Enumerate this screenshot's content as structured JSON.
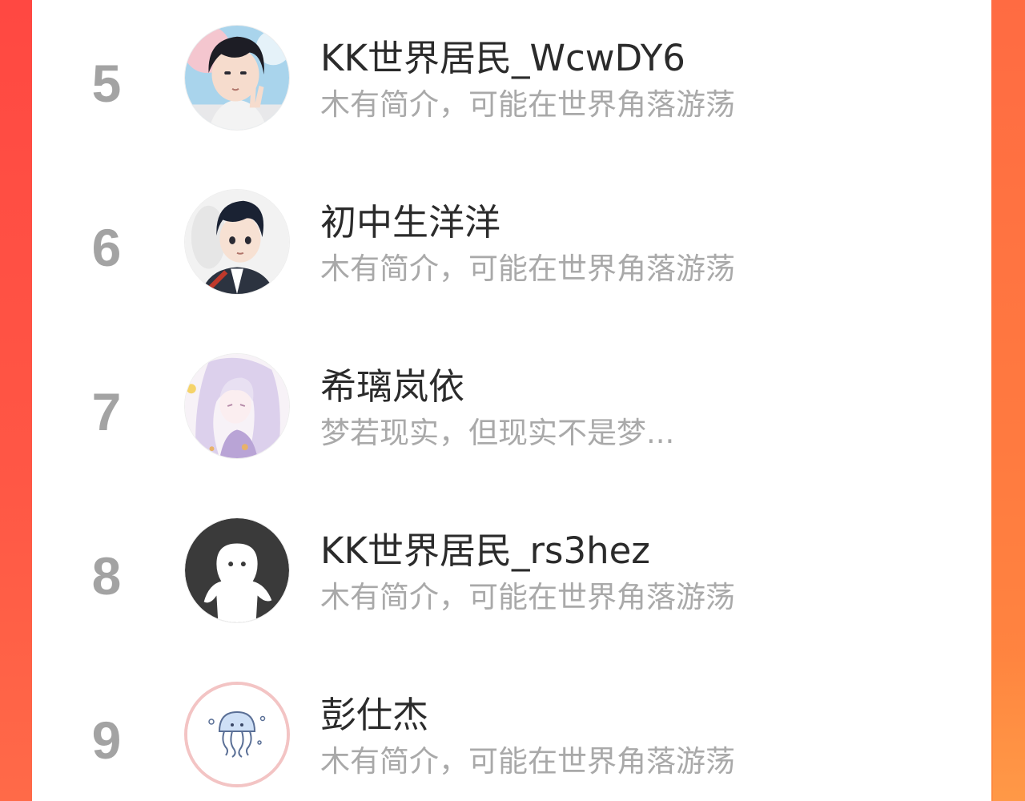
{
  "ranking": {
    "items": [
      {
        "rank": "5",
        "name": "KK世界居民_WcwDY6",
        "bio": "木有简介，可能在世界角落游荡",
        "avatar_icon": "anime-boy-peace-sign-avatar"
      },
      {
        "rank": "6",
        "name": "初中生洋洋",
        "bio": "木有简介，可能在世界角落游荡",
        "avatar_icon": "anime-boy-backpack-avatar"
      },
      {
        "rank": "7",
        "name": "希璃岚依",
        "bio": "梦若现实，但现实不是梦...",
        "avatar_icon": "anime-girl-lavender-avatar"
      },
      {
        "rank": "8",
        "name": "KK世界居民_rs3hez",
        "bio": "木有简介，可能在世界角落游荡",
        "avatar_icon": "default-ghost-avatar"
      },
      {
        "rank": "9",
        "name": "彭仕杰",
        "bio": "木有简介，可能在世界角落游荡",
        "avatar_icon": "jellyfish-avatar"
      }
    ]
  },
  "colors": {
    "background_gradient_start": "#ff4b45",
    "background_gradient_end": "#ff7b43",
    "rank_number": "#a3a3a3",
    "name_text": "#2b2b2b",
    "bio_text": "#a9a9a9"
  }
}
